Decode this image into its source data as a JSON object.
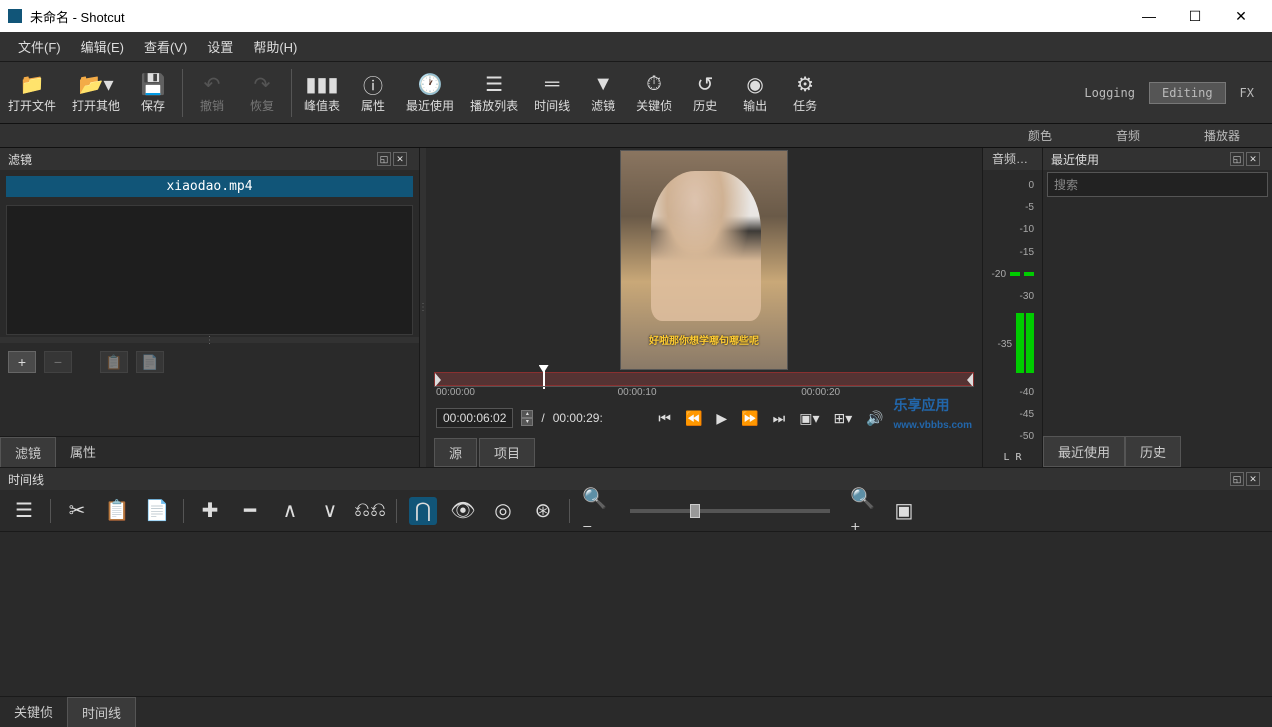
{
  "title": "未命名 - Shotcut",
  "menu": {
    "file": "文件(F)",
    "edit": "编辑(E)",
    "view": "查看(V)",
    "settings": "设置",
    "help": "帮助(H)"
  },
  "toolbar": {
    "open_file": "打开文件",
    "open_other": "打开其他",
    "save": "保存",
    "undo": "撤销",
    "redo": "恢复",
    "peak_meter": "峰值表",
    "properties": "属性",
    "recent": "最近使用",
    "playlist": "播放列表",
    "timeline": "时间线",
    "filters": "滤镜",
    "keyframes": "关键侦",
    "history": "历史",
    "export": "输出",
    "jobs": "任务"
  },
  "modes": {
    "logging": "Logging",
    "editing": "Editing",
    "fx": "FX",
    "color": "颜色",
    "audio": "音频",
    "player": "播放器"
  },
  "left": {
    "header": "滤镜",
    "file_name": "xiaodao.mp4",
    "tab_filters": "滤镜",
    "tab_properties": "属性"
  },
  "player": {
    "caption": "好啦那你想学哪句哪些呢",
    "tc_current": "00:00:06:02",
    "tc_sep": "/",
    "tc_total": "00:00:29:",
    "tick0": "00:00:00",
    "tick1": "00:00:10",
    "tick2": "00:00:20",
    "tab_source": "源",
    "tab_project": "项目",
    "watermark": "乐享应用",
    "watermark_url": "www.vbbbs.com"
  },
  "meters": {
    "header": "音频…",
    "scale": [
      "0",
      "-5",
      "-10",
      "-15",
      "-20",
      "-30",
      "-35",
      "-40",
      "-45",
      "-50"
    ],
    "lr": "L R"
  },
  "right": {
    "header": "最近使用",
    "search_placeholder": "搜索",
    "tab_recent": "最近使用",
    "tab_history": "历史"
  },
  "bottom": {
    "header": "时间线",
    "tab_keyframes": "关键侦",
    "tab_timeline": "时间线"
  }
}
